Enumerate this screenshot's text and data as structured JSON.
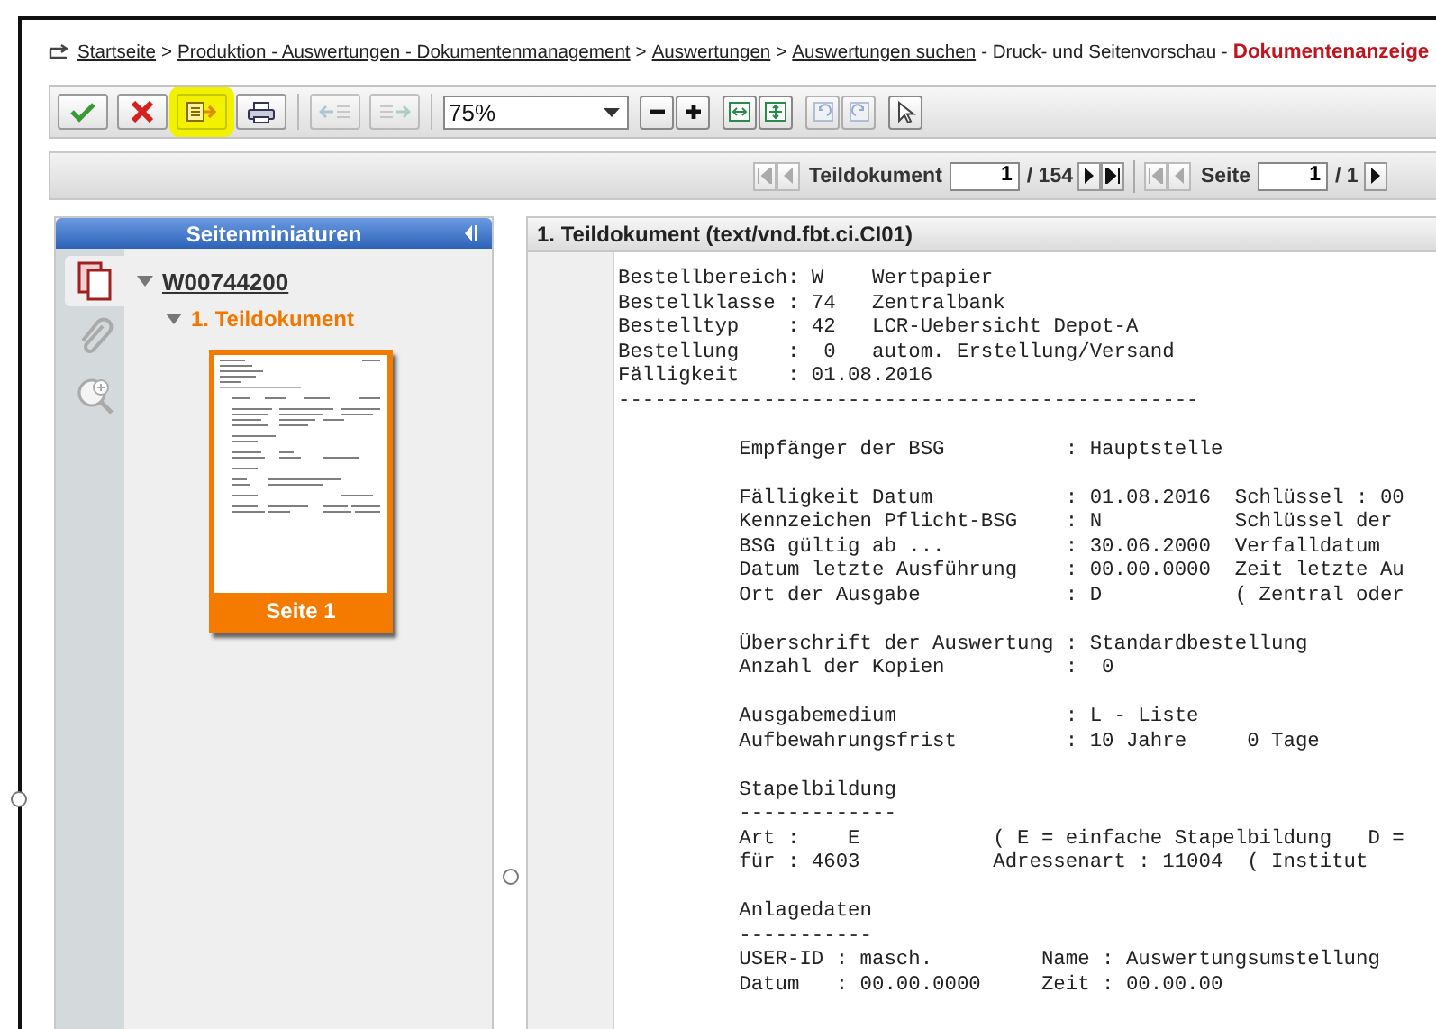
{
  "breadcrumb": [
    {
      "kind": "link",
      "text": "Startseite"
    },
    {
      "kind": "separator",
      "text": ">"
    },
    {
      "kind": "link",
      "text": "Produktion - Auswertungen - Dokumentenmanagement"
    },
    {
      "kind": "separator",
      "text": ">"
    },
    {
      "kind": "link",
      "text": "Auswertungen"
    },
    {
      "kind": "separator",
      "text": ">"
    },
    {
      "kind": "link",
      "text": "Auswertungen suchen"
    },
    {
      "kind": "plain",
      "text": "- Druck- und Seitenvorschau -"
    },
    {
      "kind": "current",
      "text": "Dokumentenanzeige"
    }
  ],
  "toolbar": {
    "groups": [
      [
        {
          "kind": "confirm",
          "disabled": false,
          "highlighted": false
        },
        {
          "kind": "cancel",
          "disabled": false,
          "highlighted": false
        },
        {
          "kind": "export",
          "disabled": false,
          "highlighted": true
        },
        {
          "kind": "print",
          "disabled": false,
          "highlighted": false
        }
      ],
      [
        {
          "kind": "move-left",
          "disabled": true,
          "highlighted": false
        },
        {
          "kind": "move-right",
          "disabled": true,
          "highlighted": false
        }
      ]
    ],
    "zoom": {
      "value": "75%"
    },
    "tools": [
      [
        {
          "kind": "zoom-out",
          "disabled": false
        },
        {
          "kind": "zoom-in",
          "disabled": false
        }
      ],
      [
        {
          "kind": "fit-width",
          "disabled": false
        },
        {
          "kind": "fit-page",
          "disabled": false
        }
      ],
      [
        {
          "kind": "rotate-left",
          "disabled": true
        },
        {
          "kind": "rotate-right",
          "disabled": true
        }
      ],
      [
        {
          "kind": "pointer",
          "disabled": false
        }
      ]
    ]
  },
  "pager": [
    {
      "label": "Teildokument",
      "value": "1",
      "total": "/ 154",
      "before": [
        {
          "kind": "first",
          "disabled": true
        },
        {
          "kind": "prev",
          "disabled": true
        }
      ],
      "after": [
        {
          "kind": "next",
          "disabled": false
        },
        {
          "kind": "last",
          "disabled": false
        }
      ]
    },
    {
      "label": "Seite",
      "value": "1",
      "total": "/ 1",
      "before": [
        {
          "kind": "first",
          "disabled": true
        },
        {
          "kind": "prev",
          "disabled": true
        }
      ],
      "after": [
        {
          "kind": "next",
          "disabled": false
        }
      ]
    }
  ],
  "thumbnails_panel": {
    "title": "Seitenminiaturen",
    "side_tabs": [
      {
        "kind": "pages",
        "selected": true
      },
      {
        "kind": "attachments",
        "selected": false
      },
      {
        "kind": "search",
        "selected": false
      }
    ],
    "tree": [
      {
        "label": "W00744200",
        "expanded": true,
        "children": [
          {
            "label": "1. Teildokument",
            "expanded": true,
            "pages": [
              {
                "label": "Seite 1",
                "selected": true
              }
            ]
          }
        ]
      }
    ]
  },
  "document_panel": {
    "title": "1. Teildokument (text/vnd.fbt.ci.CI01)",
    "header_lines": [
      "Bestellbereich: W    Wertpapier",
      "Bestellklasse : 74   Zentralbank",
      "Bestelltyp    : 42   LCR-Uebersicht Depot-A",
      "Bestellung    :  0   autom. Erstellung/Versand",
      "Fälligkeit    : 01.08.2016",
      "------------------------------------------------"
    ],
    "sections": [
      [
        "Empfänger der BSG          : Hauptstelle"
      ],
      [
        "Fälligkeit Datum           : 01.08.2016  Schlüssel : 00",
        "Kennzeichen Pflicht-BSG    : N           Schlüssel der",
        "BSG gültig ab ...          : 30.06.2000  Verfalldatum",
        "Datum letzte Ausführung    : 00.00.0000  Zeit letzte Au",
        "Ort der Ausgabe            : D           ( Zentral oder"
      ],
      [
        "Überschrift der Auswertung : Standardbestellung",
        "Anzahl der Kopien          :  0"
      ],
      [
        "Ausgabemedium              : L - Liste",
        "Aufbewahrungsfrist         : 10 Jahre     0 Tage"
      ],
      [
        "Stapelbildung",
        "-------------",
        "Art :    E           ( E = einfache Stapelbildung   D =",
        "für : 4603           Adressenart : 11004  ( Institut"
      ],
      [
        "Anlagedaten",
        "-----------",
        "USER-ID : masch.         Name : Auswertungsumstellung",
        "Datum   : 00.00.0000     Zeit : 00.00.00"
      ]
    ]
  }
}
